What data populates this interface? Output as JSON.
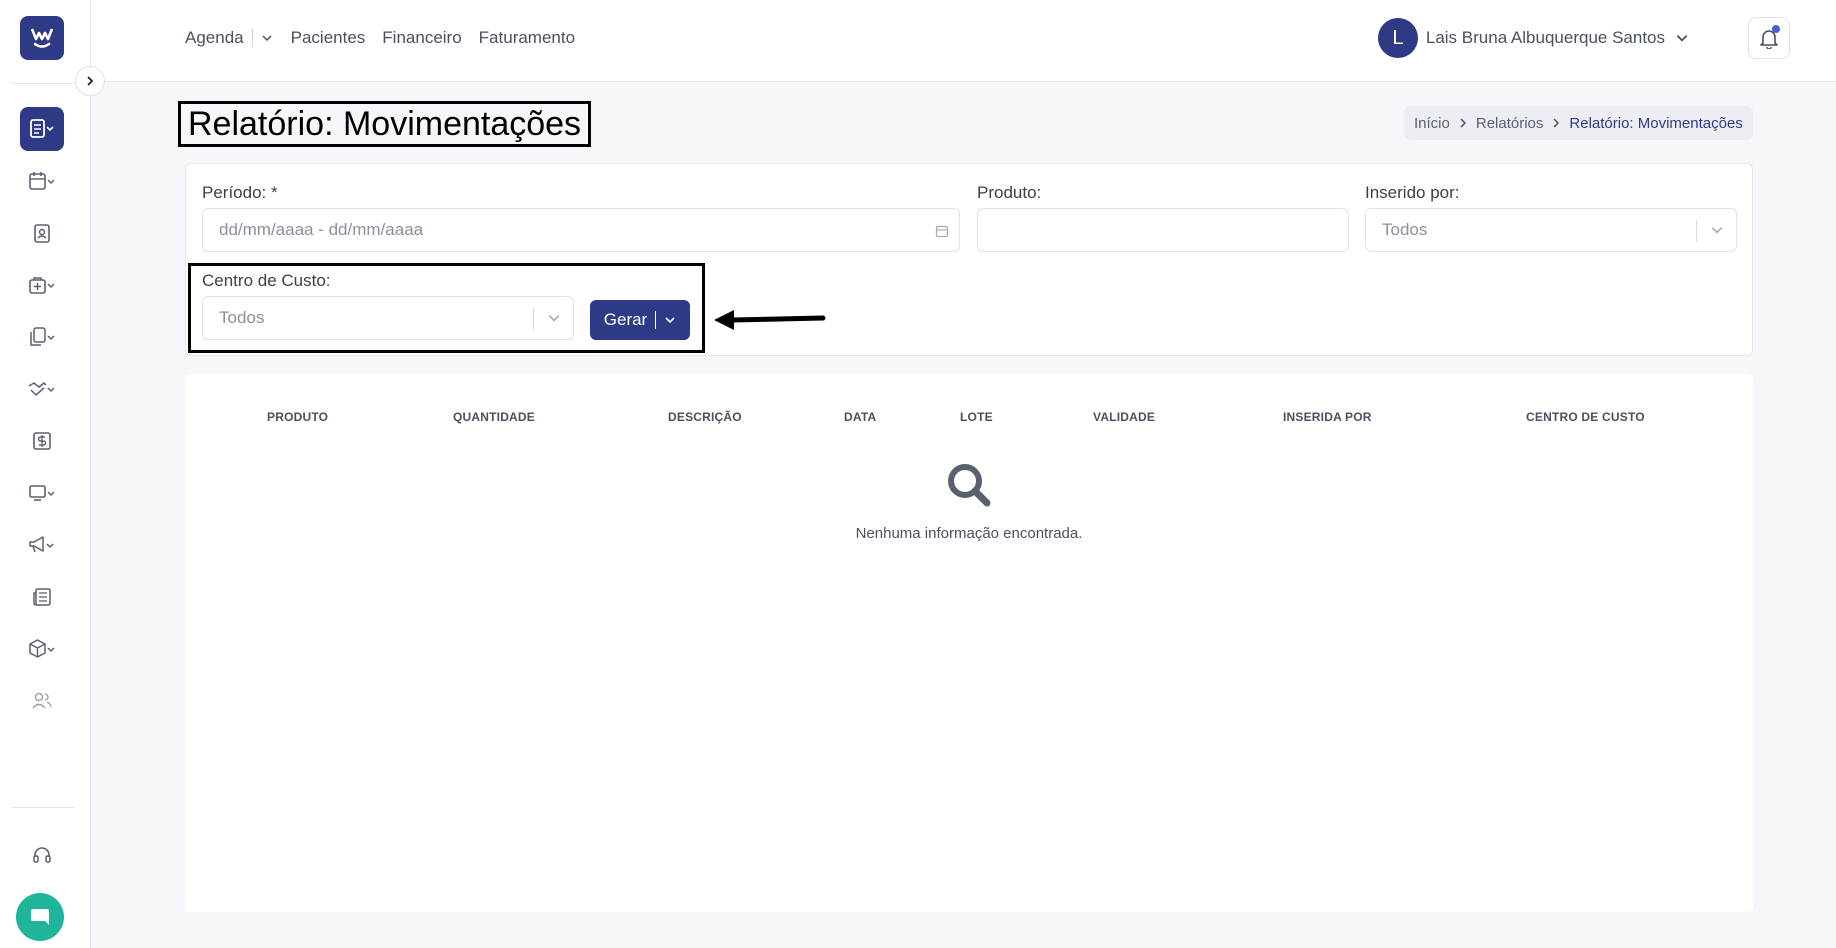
{
  "topnav": {
    "agenda": "Agenda",
    "pacientes": "Pacientes",
    "financeiro": "Financeiro",
    "faturamento": "Faturamento"
  },
  "user": {
    "initial": "L",
    "name": "Lais Bruna Albuquerque Santos"
  },
  "page": {
    "title": "Relatório: Movimentações"
  },
  "breadcrumb": {
    "inicio": "Início",
    "relatorios": "Relatórios",
    "current": "Relatório: Movimentações"
  },
  "filters": {
    "periodo_label": "Período: *",
    "periodo_placeholder": "dd/mm/aaaa - dd/mm/aaaa",
    "produto_label": "Produto:",
    "produto_value": "",
    "inserido_label": "Inserido por:",
    "inserido_value": "Todos",
    "centro_label": "Centro de Custo:",
    "centro_value": "Todos",
    "gerar_label": "Gerar"
  },
  "table": {
    "columns": [
      "PRODUTO",
      "QUANTIDADE",
      "DESCRIÇÃO",
      "DATA",
      "LOTE",
      "VALIDADE",
      "INSERIDA POR",
      "CENTRO DE CUSTO"
    ],
    "empty_message": "Nenhuma informação encontrada."
  },
  "sidebar": {
    "icons": [
      "reports-icon",
      "calendar-icon",
      "patient-badge-icon",
      "medical-case-icon",
      "documents-icon",
      "handshake-icon",
      "dollar-icon",
      "monitor-icon",
      "megaphone-icon",
      "newspaper-icon",
      "box-icon",
      "users-icon"
    ]
  },
  "colors": {
    "primary": "#2f3a87",
    "chat": "#1fb59a",
    "background": "#f6f7fb"
  }
}
